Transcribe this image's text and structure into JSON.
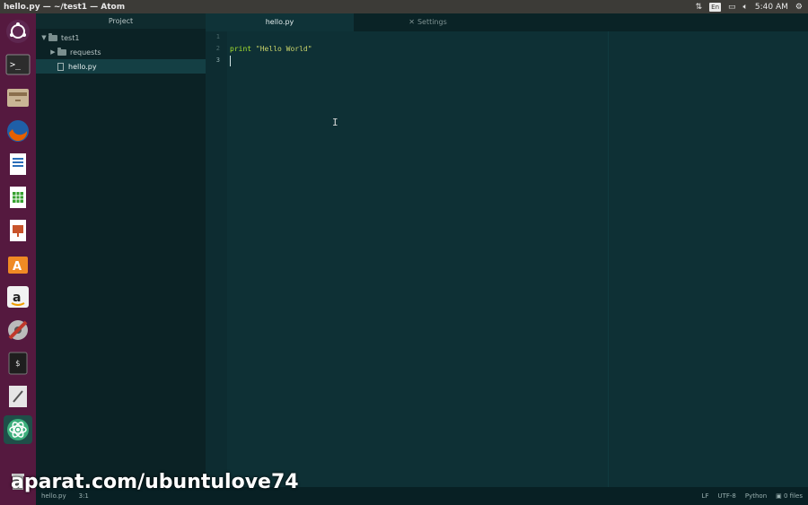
{
  "window": {
    "title": "hello.py — ~/test1 — Atom"
  },
  "topbar": {
    "keyboard": "En",
    "time": "5:40 AM"
  },
  "launcher": {
    "items": [
      {
        "name": "ubuntu-dash-icon",
        "color": "#e95420"
      },
      {
        "name": "terminal-icon",
        "color": "#2c2c2c"
      },
      {
        "name": "files-icon",
        "color": "#b59a7a"
      },
      {
        "name": "firefox-icon",
        "color": "#e66000"
      },
      {
        "name": "writer-icon",
        "color": "#2a6eb8"
      },
      {
        "name": "calc-icon",
        "color": "#36a12f"
      },
      {
        "name": "impress-icon",
        "color": "#c8542b"
      },
      {
        "name": "software-center-icon",
        "color": "#f08a24"
      },
      {
        "name": "amazon-icon",
        "color": "#e8e8e8"
      },
      {
        "name": "system-settings-icon",
        "color": "#c0392b"
      },
      {
        "name": "terminal2-icon",
        "color": "#1e1e1e"
      },
      {
        "name": "text-editor-icon",
        "color": "#d9d9d9"
      },
      {
        "name": "atom-icon",
        "color": "#3daf7c"
      }
    ]
  },
  "tree": {
    "header": "Project",
    "root": "test1",
    "folder": "requests",
    "file": "hello.py"
  },
  "tabs": [
    {
      "label": "hello.py"
    },
    {
      "label": "Settings"
    }
  ],
  "editor": {
    "line_numbers": [
      "1",
      "2",
      "3"
    ],
    "code": {
      "keyword": "print",
      "string": "\"Hello World\""
    }
  },
  "status": {
    "file": "hello.py",
    "cursor": "3:1",
    "line_ending": "LF",
    "encoding": "UTF-8",
    "grammar": "Python",
    "files": "0 files"
  },
  "watermark": "aparat.com/ubuntulove74"
}
